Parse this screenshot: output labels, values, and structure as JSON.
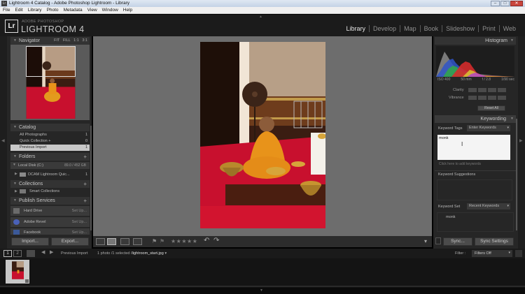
{
  "window": {
    "title": "Lightroom 4 Catalog - Adobe Photoshop Lightroom - Library",
    "min": "–",
    "max": "□",
    "close": "✕"
  },
  "menu": [
    "File",
    "Edit",
    "Library",
    "Photo",
    "Metadata",
    "View",
    "Window",
    "Help"
  ],
  "identity": {
    "logo": "Lr",
    "vendor": "ADOBE PHOTOSHOP",
    "product": "LIGHTROOM 4"
  },
  "modules": [
    {
      "label": "Library",
      "active": true
    },
    {
      "label": "Develop",
      "active": false
    },
    {
      "label": "Map",
      "active": false
    },
    {
      "label": "Book",
      "active": false
    },
    {
      "label": "Slideshow",
      "active": false
    },
    {
      "label": "Print",
      "active": false
    },
    {
      "label": "Web",
      "active": false
    }
  ],
  "navigator": {
    "title": "Navigator",
    "zoom": [
      "FIT",
      "FILL",
      "1:1",
      "3:1"
    ]
  },
  "catalog": {
    "title": "Catalog",
    "items": [
      {
        "label": "All Photographs",
        "count": "1"
      },
      {
        "label": "Quick Collection +",
        "count": "0"
      },
      {
        "label": "Previous Import",
        "count": "1"
      }
    ]
  },
  "folders": {
    "title": "Folders",
    "disk": {
      "label": "Local Disk (C:)",
      "size": "89.0 / 452 GB"
    },
    "items": [
      {
        "label": "DCAM Lightroom Quic...",
        "count": "1"
      }
    ]
  },
  "collections": {
    "title": "Collections",
    "items": [
      {
        "label": "Smart Collections"
      }
    ]
  },
  "publish": {
    "title": "Publish Services",
    "items": [
      {
        "label": "Hard Drive",
        "action": "Set Up..."
      },
      {
        "label": "Adobe Revel",
        "action": "Set Up..."
      },
      {
        "label": "Facebook",
        "action": "Set Up..."
      }
    ]
  },
  "left_buttons": {
    "import": "Import...",
    "export": "Export..."
  },
  "histogram": {
    "title": "Histogram",
    "info": [
      "ISO 400",
      "50 mm",
      "f / 2.8",
      "1/90 sec"
    ]
  },
  "quick_develop": {
    "rows": [
      {
        "label": "Clarity"
      },
      {
        "label": "Vibrance"
      }
    ],
    "reset": "Reset All"
  },
  "keywording": {
    "title": "Keywording",
    "tags_label": "Keyword Tags",
    "tags_mode": "Enter Keywords",
    "entry_value": "monk",
    "hint": "Click here to add keywords",
    "suggestions_title": "Keyword Suggestions",
    "set_label": "Keyword Set",
    "set_value": "Recent Keywords",
    "set_items": [
      "monk"
    ]
  },
  "right_buttons": {
    "sync": "Sync...",
    "sync_settings": "Sync Settings"
  },
  "toolbar": {
    "stars": "★★★★★",
    "rotate_left": "↶",
    "rotate_right": "↷",
    "dropdown": "▾"
  },
  "filmbar": {
    "pages": [
      "1",
      "2"
    ],
    "source": "Previous Import",
    "status_prefix": "1 photo /1 selected /",
    "filename": "lightroom_start.jpg",
    "filter_label": "Filter :",
    "filter_value": "Filters Off"
  },
  "colors": {
    "accent_red": "#c8102e",
    "panel_bg": "#262626",
    "center_bg": "#6d6d6d"
  }
}
